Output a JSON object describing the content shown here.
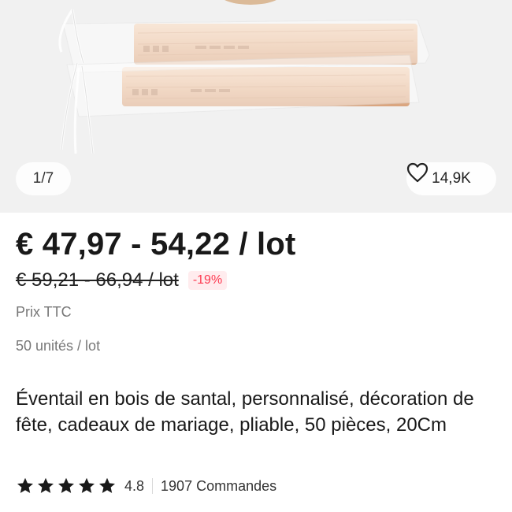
{
  "gallery": {
    "counter": "1/7",
    "favorites_count": "14,9K",
    "icons": {
      "favorite": "heart-outline-icon"
    }
  },
  "pricing": {
    "current_price": "€ 47,97 - 54,22 / lot",
    "original_price": "€ 59,21 - 66,94 / lot",
    "discount": "-19%",
    "tax_note": "Prix TTC",
    "unit_info": "50 unités / lot",
    "colors": {
      "discount_text": "#fd384f",
      "discount_bg": "#ffecee"
    }
  },
  "product": {
    "title": "Éventail en bois de santal, personnalisé, décoration de fête, cadeaux de mariage, pliable, 50 pièces, 20Cm"
  },
  "rating": {
    "stars": 5,
    "value": "4.8",
    "orders": "1907 Commandes",
    "star_color": "#191919"
  }
}
